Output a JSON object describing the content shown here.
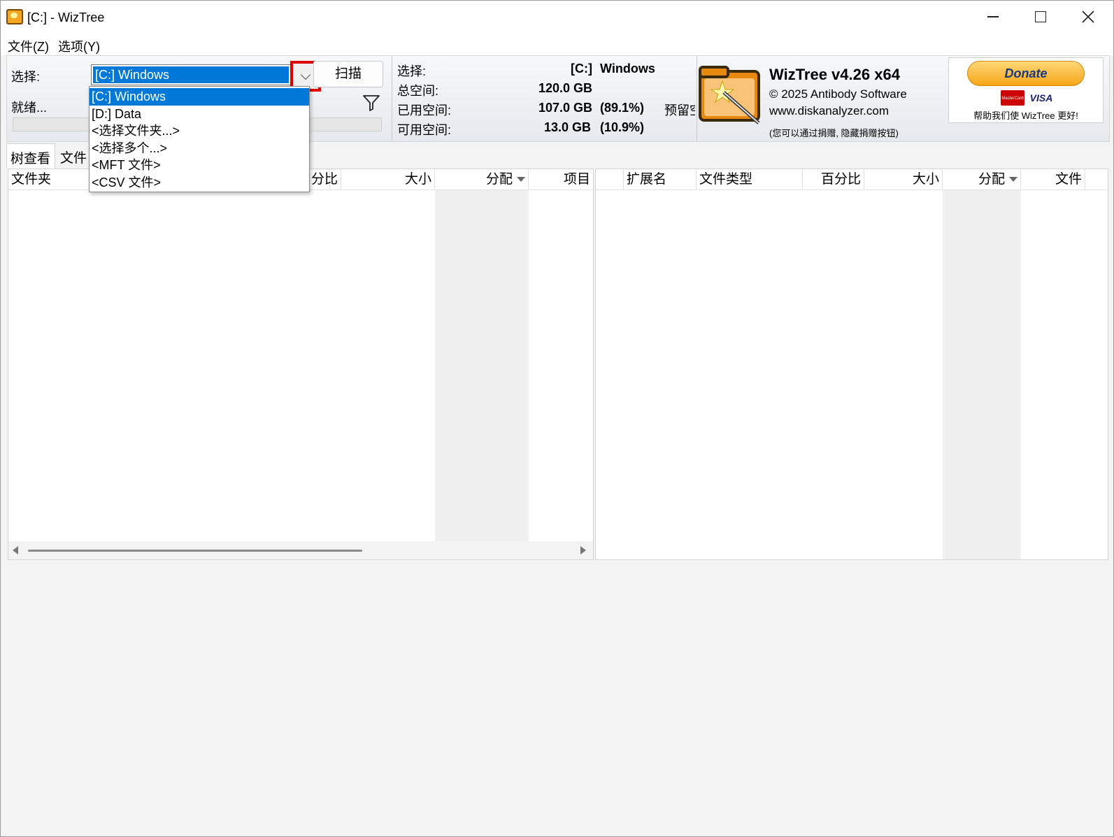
{
  "window": {
    "title": "[C:]  - WizTree"
  },
  "menu": {
    "file": "文件(Z)",
    "options": "选项(Y)"
  },
  "toolbar": {
    "select_label": "选择:",
    "combo_value": "[C:] Windows",
    "scan_label": "扫描",
    "status": "就绪..."
  },
  "drive_info": {
    "select_label": "选择:",
    "drive": "[C:]",
    "drive_name": "Windows",
    "total_label": "总空间:",
    "total_value": "120.0 GB",
    "used_label": "已用空间:",
    "used_value": "107.0 GB",
    "used_pct": "(89.1%)",
    "reserved_label": "预留空",
    "free_label": "可用空间:",
    "free_value": "13.0 GB",
    "free_pct": "(10.9%)"
  },
  "about": {
    "product": "WizTree v4.26 x64",
    "copyright": "© 2025 Antibody Software",
    "website": "www.diskanalyzer.com",
    "note": "(您可以通过捐赠, 隐藏捐赠按钮)"
  },
  "donate": {
    "button": "Donate",
    "card1": "MasterCard",
    "card2": "VISA",
    "text": "帮助我们使 WizTree 更好!"
  },
  "tabs": {
    "tree": "树查看",
    "files": "文件"
  },
  "left_table": {
    "columns": [
      "文件夹",
      "分比",
      "大小",
      "分配",
      "项目"
    ]
  },
  "right_table": {
    "columns": [
      "扩展名",
      "文件类型",
      "百分比",
      "大小",
      "分配",
      "文件"
    ]
  },
  "dropdown": {
    "items": [
      "[C:] Windows",
      "[D:] Data",
      "<选择文件夹...>",
      "<选择多个...>",
      "<MFT 文件>",
      "<CSV 文件>"
    ],
    "selected_index": 0
  },
  "colors": {
    "selection": "#0078d7",
    "highlight_box": "#e00000"
  }
}
